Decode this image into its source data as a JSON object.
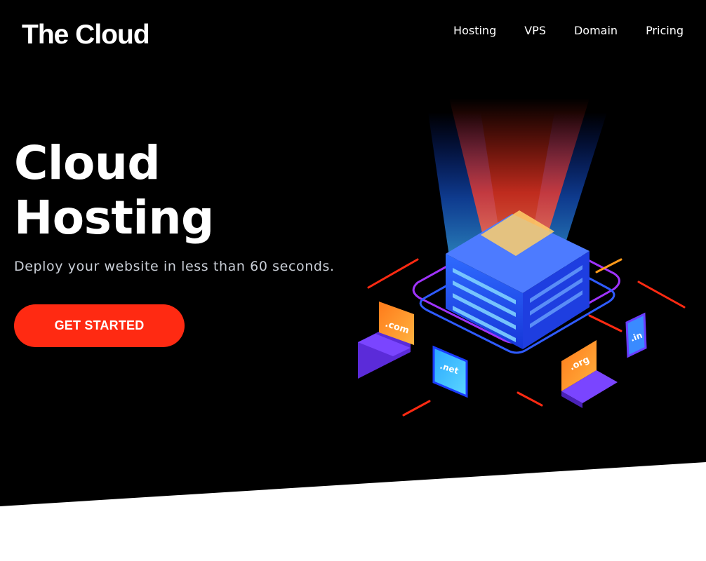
{
  "brand": {
    "logo_text": "The Cloud"
  },
  "nav": {
    "items": [
      {
        "label": "Hosting"
      },
      {
        "label": "VPS"
      },
      {
        "label": "Domain"
      },
      {
        "label": "Pricing"
      }
    ]
  },
  "hero": {
    "title_line1": "Cloud",
    "title_line2": "Hosting",
    "subtitle": "Deploy your website in less than 60 seconds.",
    "cta_label": "GET STARTED"
  },
  "illustration": {
    "domain_labels": {
      "com": ".com",
      "net": ".net",
      "org": ".org",
      "in": ".in"
    },
    "icon": "isometric-cloud-server-icon"
  },
  "colors": {
    "hero_background": "#000000",
    "cta_background": "#ff2a12",
    "text_primary": "#ffffff",
    "text_secondary": "#c9ced6",
    "page_background": "#ffffff"
  }
}
